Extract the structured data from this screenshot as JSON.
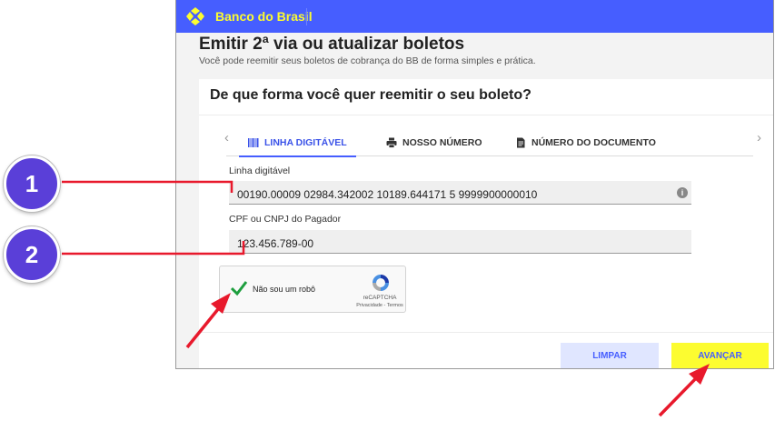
{
  "header": {
    "brand": "Banco do Brasil",
    "logo_icon": "banco-do-brasil-logo-icon",
    "colors": {
      "bar": "#465eff",
      "brand_text": "#fcfc30"
    }
  },
  "page": {
    "title": "Emitir 2ª via ou atualizar boletos",
    "subtitle": "Você pode reemitir seus boletos de cobrança do BB de forma simples e prática."
  },
  "form": {
    "question": "De que forma você quer reemitir o seu boleto?",
    "tabs": [
      {
        "label": "LINHA DIGITÁVEL",
        "icon": "barcode-icon",
        "active": true
      },
      {
        "label": "NOSSO NÚMERO",
        "icon": "printer-icon",
        "active": false
      },
      {
        "label": "NÚMERO DO DOCUMENTO",
        "icon": "document-icon",
        "active": false
      }
    ],
    "linha_label": "Linha digitável",
    "linha_value": "00190.00009 02984.342002 10189.644171 5 9999900000010",
    "cpf_label": "CPF ou CNPJ do Pagador",
    "cpf_value": "123.456.789-00",
    "captcha": {
      "label": "Não sou um robô",
      "brand": "reCAPTCHA",
      "links": "Privacidade - Termos",
      "checked": true
    },
    "buttons": {
      "clear": "LIMPAR",
      "next": "AVANÇAR"
    }
  },
  "annotations": {
    "markers": [
      "1",
      "2"
    ],
    "arrow_color": "#e8192c",
    "marker_color": "#5a3fd8"
  }
}
